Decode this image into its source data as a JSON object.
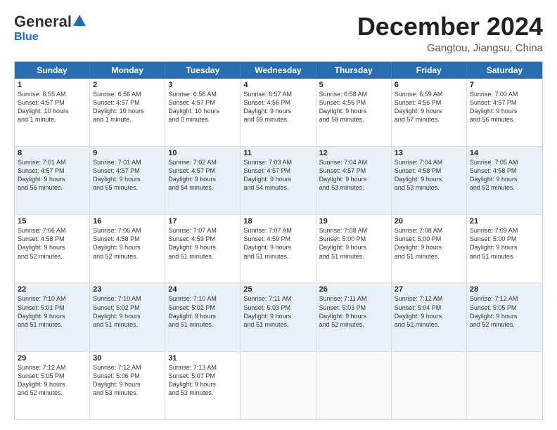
{
  "header": {
    "logo_general": "General",
    "logo_blue": "Blue",
    "month_title": "December 2024",
    "location": "Gangtou, Jiangsu, China"
  },
  "weekdays": [
    "Sunday",
    "Monday",
    "Tuesday",
    "Wednesday",
    "Thursday",
    "Friday",
    "Saturday"
  ],
  "rows": [
    {
      "cells": [
        {
          "day": "1",
          "lines": [
            "Sunrise: 6:55 AM",
            "Sunset: 4:57 PM",
            "Daylight: 10 hours",
            "and 1 minute."
          ]
        },
        {
          "day": "2",
          "lines": [
            "Sunrise: 6:56 AM",
            "Sunset: 4:57 PM",
            "Daylight: 10 hours",
            "and 1 minute."
          ]
        },
        {
          "day": "3",
          "lines": [
            "Sunrise: 6:56 AM",
            "Sunset: 4:57 PM",
            "Daylight: 10 hours",
            "and 0 minutes."
          ]
        },
        {
          "day": "4",
          "lines": [
            "Sunrise: 6:57 AM",
            "Sunset: 4:56 PM",
            "Daylight: 9 hours",
            "and 59 minutes."
          ]
        },
        {
          "day": "5",
          "lines": [
            "Sunrise: 6:58 AM",
            "Sunset: 4:56 PM",
            "Daylight: 9 hours",
            "and 58 minutes."
          ]
        },
        {
          "day": "6",
          "lines": [
            "Sunrise: 6:59 AM",
            "Sunset: 4:56 PM",
            "Daylight: 9 hours",
            "and 57 minutes."
          ]
        },
        {
          "day": "7",
          "lines": [
            "Sunrise: 7:00 AM",
            "Sunset: 4:57 PM",
            "Daylight: 9 hours",
            "and 56 minutes."
          ]
        }
      ]
    },
    {
      "cells": [
        {
          "day": "8",
          "lines": [
            "Sunrise: 7:01 AM",
            "Sunset: 4:57 PM",
            "Daylight: 9 hours",
            "and 56 minutes."
          ]
        },
        {
          "day": "9",
          "lines": [
            "Sunrise: 7:01 AM",
            "Sunset: 4:57 PM",
            "Daylight: 9 hours",
            "and 55 minutes."
          ]
        },
        {
          "day": "10",
          "lines": [
            "Sunrise: 7:02 AM",
            "Sunset: 4:57 PM",
            "Daylight: 9 hours",
            "and 54 minutes."
          ]
        },
        {
          "day": "11",
          "lines": [
            "Sunrise: 7:03 AM",
            "Sunset: 4:57 PM",
            "Daylight: 9 hours",
            "and 54 minutes."
          ]
        },
        {
          "day": "12",
          "lines": [
            "Sunrise: 7:04 AM",
            "Sunset: 4:57 PM",
            "Daylight: 9 hours",
            "and 53 minutes."
          ]
        },
        {
          "day": "13",
          "lines": [
            "Sunrise: 7:04 AM",
            "Sunset: 4:58 PM",
            "Daylight: 9 hours",
            "and 53 minutes."
          ]
        },
        {
          "day": "14",
          "lines": [
            "Sunrise: 7:05 AM",
            "Sunset: 4:58 PM",
            "Daylight: 9 hours",
            "and 52 minutes."
          ]
        }
      ]
    },
    {
      "cells": [
        {
          "day": "15",
          "lines": [
            "Sunrise: 7:06 AM",
            "Sunset: 4:58 PM",
            "Daylight: 9 hours",
            "and 52 minutes."
          ]
        },
        {
          "day": "16",
          "lines": [
            "Sunrise: 7:06 AM",
            "Sunset: 4:58 PM",
            "Daylight: 9 hours",
            "and 52 minutes."
          ]
        },
        {
          "day": "17",
          "lines": [
            "Sunrise: 7:07 AM",
            "Sunset: 4:59 PM",
            "Daylight: 9 hours",
            "and 51 minutes."
          ]
        },
        {
          "day": "18",
          "lines": [
            "Sunrise: 7:07 AM",
            "Sunset: 4:59 PM",
            "Daylight: 9 hours",
            "and 51 minutes."
          ]
        },
        {
          "day": "19",
          "lines": [
            "Sunrise: 7:08 AM",
            "Sunset: 5:00 PM",
            "Daylight: 9 hours",
            "and 51 minutes."
          ]
        },
        {
          "day": "20",
          "lines": [
            "Sunrise: 7:08 AM",
            "Sunset: 5:00 PM",
            "Daylight: 9 hours",
            "and 51 minutes."
          ]
        },
        {
          "day": "21",
          "lines": [
            "Sunrise: 7:09 AM",
            "Sunset: 5:00 PM",
            "Daylight: 9 hours",
            "and 51 minutes."
          ]
        }
      ]
    },
    {
      "cells": [
        {
          "day": "22",
          "lines": [
            "Sunrise: 7:10 AM",
            "Sunset: 5:01 PM",
            "Daylight: 9 hours",
            "and 51 minutes."
          ]
        },
        {
          "day": "23",
          "lines": [
            "Sunrise: 7:10 AM",
            "Sunset: 5:02 PM",
            "Daylight: 9 hours",
            "and 51 minutes."
          ]
        },
        {
          "day": "24",
          "lines": [
            "Sunrise: 7:10 AM",
            "Sunset: 5:02 PM",
            "Daylight: 9 hours",
            "and 51 minutes."
          ]
        },
        {
          "day": "25",
          "lines": [
            "Sunrise: 7:11 AM",
            "Sunset: 5:03 PM",
            "Daylight: 9 hours",
            "and 51 minutes."
          ]
        },
        {
          "day": "26",
          "lines": [
            "Sunrise: 7:11 AM",
            "Sunset: 5:03 PM",
            "Daylight: 9 hours",
            "and 52 minutes."
          ]
        },
        {
          "day": "27",
          "lines": [
            "Sunrise: 7:12 AM",
            "Sunset: 5:04 PM",
            "Daylight: 9 hours",
            "and 52 minutes."
          ]
        },
        {
          "day": "28",
          "lines": [
            "Sunrise: 7:12 AM",
            "Sunset: 5:05 PM",
            "Daylight: 9 hours",
            "and 52 minutes."
          ]
        }
      ]
    },
    {
      "cells": [
        {
          "day": "29",
          "lines": [
            "Sunrise: 7:12 AM",
            "Sunset: 5:05 PM",
            "Daylight: 9 hours",
            "and 52 minutes."
          ]
        },
        {
          "day": "30",
          "lines": [
            "Sunrise: 7:12 AM",
            "Sunset: 5:06 PM",
            "Daylight: 9 hours",
            "and 53 minutes."
          ]
        },
        {
          "day": "31",
          "lines": [
            "Sunrise: 7:13 AM",
            "Sunset: 5:07 PM",
            "Daylight: 9 hours",
            "and 53 minutes."
          ]
        },
        {
          "day": "",
          "lines": []
        },
        {
          "day": "",
          "lines": []
        },
        {
          "day": "",
          "lines": []
        },
        {
          "day": "",
          "lines": []
        }
      ]
    }
  ]
}
